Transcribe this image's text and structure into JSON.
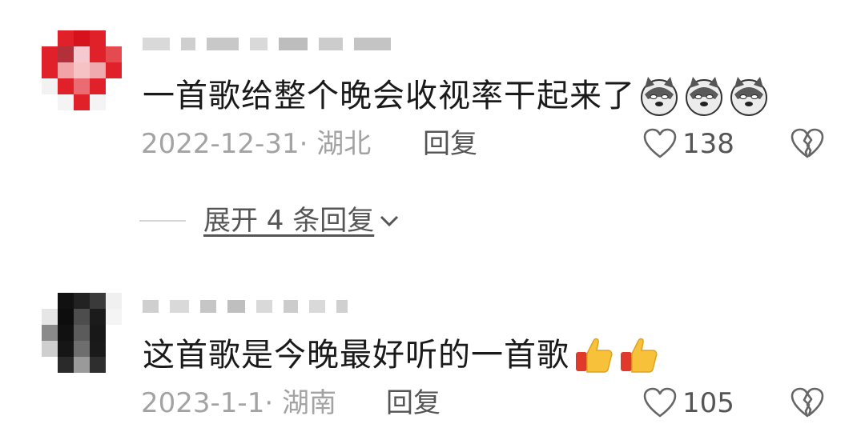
{
  "comments": [
    {
      "text": "一首歌给整个晚会收视率干起来了",
      "date_location": "2022-12-31· 湖北",
      "reply_label": "回复",
      "like_count": "138",
      "emojis": [
        "doge-dog-icon",
        "doge-dog-icon",
        "doge-dog-icon"
      ]
    },
    {
      "text": "这首歌是今晚最好听的一首歌",
      "date_location": "2023-1-1· 湖南",
      "reply_label": "回复",
      "like_count": "105",
      "emojis": [
        "thumbs-up-icon",
        "thumbs-up-icon"
      ]
    }
  ],
  "expand_replies_label": "展开 4 条回复",
  "colors": {
    "text_primary": "#1a1a1a",
    "text_meta": "#a3a3a3",
    "text_action": "#555555",
    "avatar1": "#e0212a",
    "avatar2": "#1c1c1c"
  }
}
